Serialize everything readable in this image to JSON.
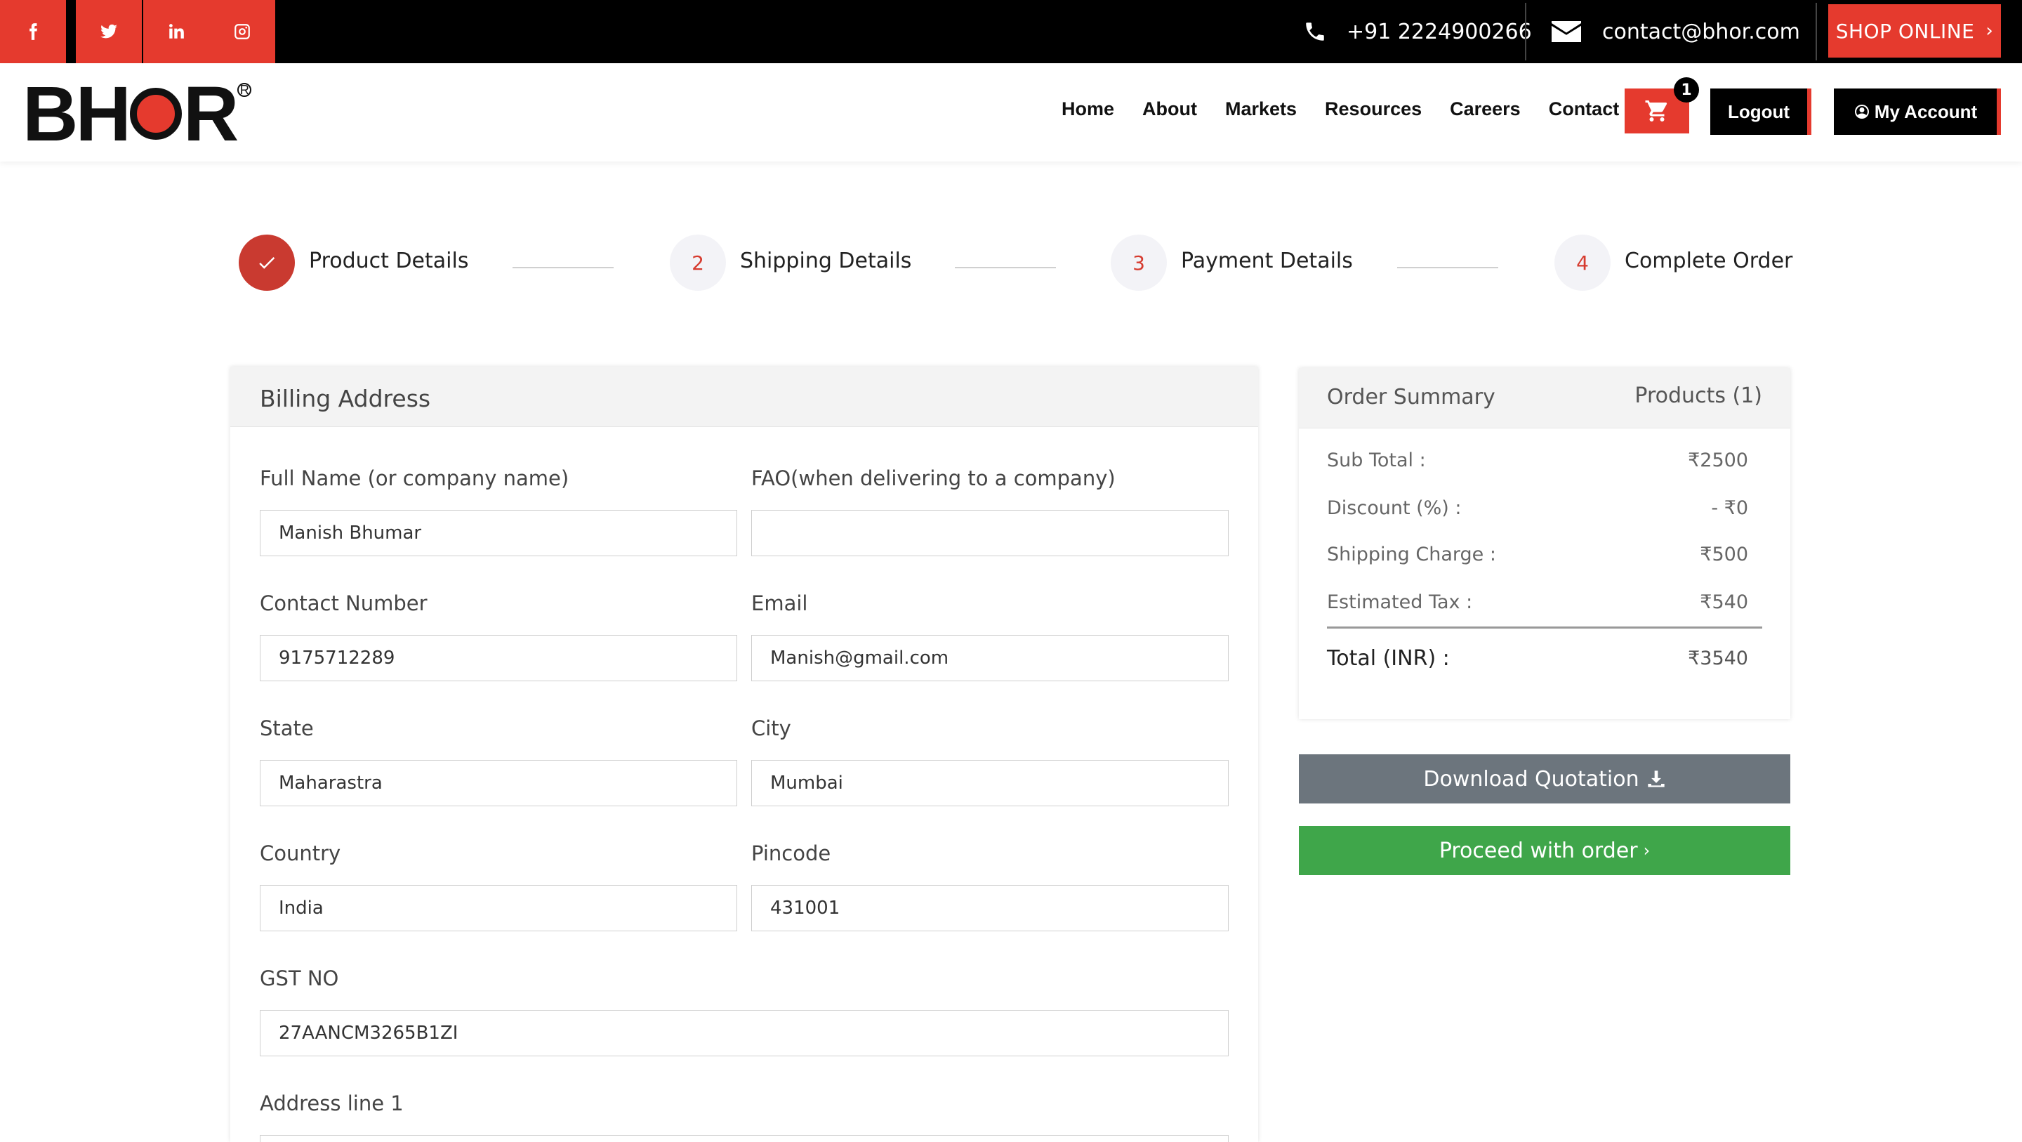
{
  "topbar": {
    "social": [
      {
        "name": "facebook",
        "icon": "facebook-icon"
      },
      {
        "name": "twitter",
        "icon": "twitter-icon"
      },
      {
        "name": "linkedin",
        "icon": "linkedin-icon"
      },
      {
        "name": "instagram",
        "icon": "instagram-icon"
      }
    ],
    "phone": "+91 2224900266",
    "email": "contact@bhor.com",
    "shop_online": "SHOP ONLINE",
    "shop_chevron": "›"
  },
  "header": {
    "logo_text_1": "BH",
    "logo_text_2": "R",
    "logo_reg": "R",
    "nav": {
      "home": "Home",
      "about": "About",
      "markets": "Markets",
      "resources": "Resources",
      "careers": "Careers",
      "contact": "Contact"
    },
    "cart_count": "1",
    "logout": "Logout",
    "my_account": "My Account"
  },
  "steps": [
    {
      "number": "",
      "label": "Product Details",
      "status": "done"
    },
    {
      "number": "2",
      "label": "Shipping Details",
      "status": "pending"
    },
    {
      "number": "3",
      "label": "Payment Details",
      "status": "pending"
    },
    {
      "number": "4",
      "label": "Complete Order",
      "status": "pending"
    }
  ],
  "billing": {
    "title": "Billing Address",
    "full_name_label": "Full Name (or company name)",
    "full_name_value": "Manish Bhumar",
    "fao_label": "FAO(when delivering to a company)",
    "fao_value": "",
    "contact_label": "Contact Number",
    "contact_value": "9175712289",
    "email_label": "Email",
    "email_value": "Manish@gmail.com",
    "state_label": "State",
    "state_value": "Maharastra",
    "city_label": "City",
    "city_value": "Mumbai",
    "country_label": "Country",
    "country_value": "India",
    "pincode_label": "Pincode",
    "pincode_value": "431001",
    "gst_label": "GST NO",
    "gst_value": "27AANCM3265B1ZI",
    "address1_label": "Address line 1",
    "address1_value": ""
  },
  "summary": {
    "title": "Order Summary",
    "products": "Products (1)",
    "subtotal_label": "Sub Total :",
    "subtotal_value": "₹2500",
    "discount_label": "Discount (%) :",
    "discount_value": "- ₹0",
    "shipping_label": "Shipping Charge :",
    "shipping_value": "₹500",
    "tax_label": "Estimated Tax :",
    "tax_value": "₹540",
    "total_label": "Total (INR) :",
    "total_value": "₹3540"
  },
  "actions": {
    "download": "Download Quotation",
    "proceed": "Proceed with order",
    "proceed_chevron": "›"
  },
  "colors": {
    "brand_red": "#e53a2e",
    "download_gray": "#6c757d",
    "proceed_green": "#3fa64a"
  }
}
